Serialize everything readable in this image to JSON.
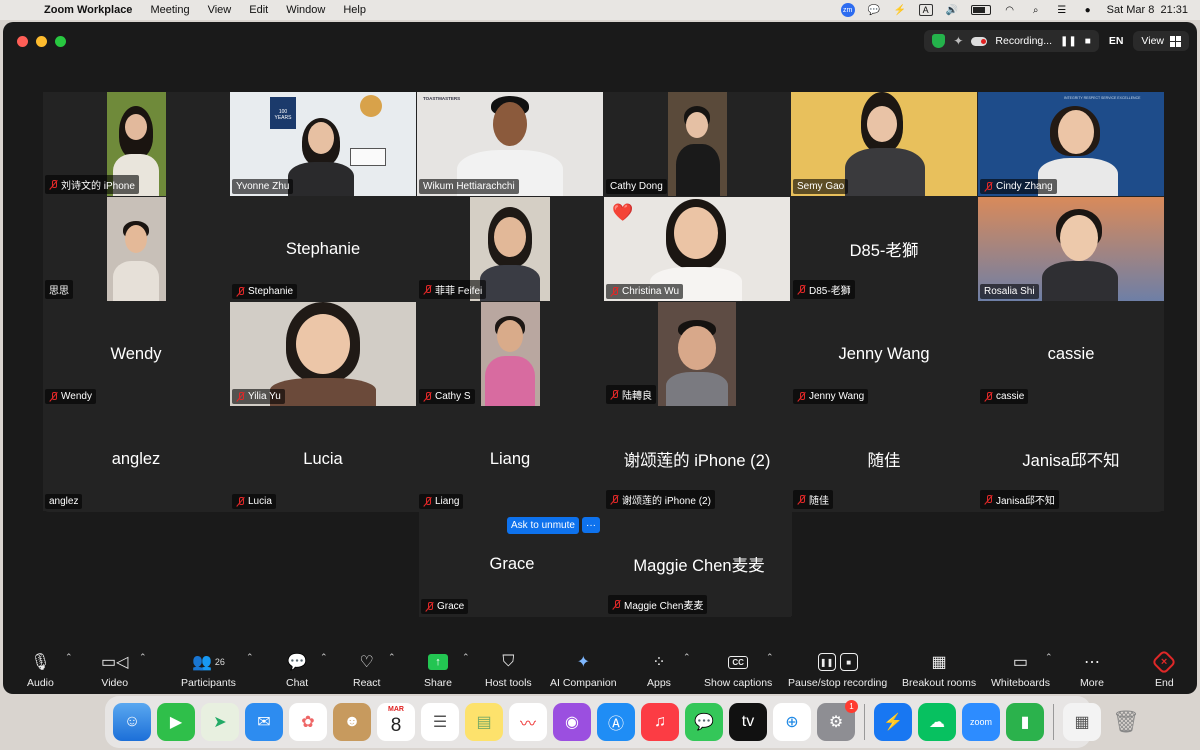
{
  "menubar": {
    "app_name": "Zoom Workplace",
    "menus": [
      "Meeting",
      "View",
      "Edit",
      "Window",
      "Help"
    ],
    "zm_badge": "zm",
    "a_badge": "A",
    "datetime": "Sat Mar 8  21:31"
  },
  "titlebar": {
    "recording_status": "Recording...",
    "language": "EN",
    "view_label": "View"
  },
  "participants": [
    {
      "name": "刘诗文的 iPhone",
      "muted": true,
      "video": true
    },
    {
      "name": "Yvonne Zhu",
      "muted": false,
      "video": true,
      "active": true
    },
    {
      "name": "Wikum Hettiarachchi",
      "muted": false,
      "video": true
    },
    {
      "name": "Cathy Dong",
      "muted": false,
      "video": true
    },
    {
      "name": "Semy Gao",
      "muted": false,
      "video": true
    },
    {
      "name": "Cindy Zhang",
      "muted": true,
      "video": true
    },
    {
      "name": "思思",
      "muted": false,
      "video": true
    },
    {
      "name": "Stephanie",
      "muted": true,
      "video": false
    },
    {
      "name": "菲菲 Feifei",
      "muted": true,
      "video": true
    },
    {
      "name": "Christina Wu",
      "muted": true,
      "video": true
    },
    {
      "name": "D85-老獅",
      "muted": true,
      "video": false
    },
    {
      "name": "Rosalia Shi",
      "muted": true,
      "video": true
    },
    {
      "name": "Wendy",
      "muted": true,
      "video": false
    },
    {
      "name": "Yilia Yu",
      "muted": true,
      "video": true
    },
    {
      "name": "Cathy S",
      "muted": true,
      "video": true
    },
    {
      "name": "陆轉良",
      "muted": true,
      "video": true
    },
    {
      "name": "Jenny Wang",
      "muted": true,
      "video": false
    },
    {
      "name": "cassie",
      "muted": true,
      "video": false
    },
    {
      "name": "anglez",
      "muted": false,
      "video": false
    },
    {
      "name": "Lucia",
      "muted": true,
      "video": false
    },
    {
      "name": "Liang",
      "muted": true,
      "video": false
    },
    {
      "name": "谢颂莲的 iPhone (2)",
      "muted": true,
      "video": false
    },
    {
      "name": "随佳",
      "muted": true,
      "video": false
    },
    {
      "name": "Janisa邱不知",
      "muted": true,
      "video": false
    },
    {
      "name": "Grace",
      "muted": true,
      "video": false
    },
    {
      "name": "Maggie Chen麦麦",
      "muted": true,
      "video": false
    }
  ],
  "reaction_emoji": "❤️",
  "overlay_text": {
    "wikum_banner": "TOASTMASTERS",
    "yvonne_poster": "100 YEARS",
    "cindy_banner": "INTEGRITY   RESPECT   SERVICE   EXCELLENCE"
  },
  "ask_to_unmute": "Ask to unmute",
  "more_dots": "···",
  "toolbar": {
    "audio": "Audio",
    "video": "Video",
    "participants": "Participants",
    "participants_count": "26",
    "chat": "Chat",
    "react": "React",
    "share": "Share",
    "host_tools": "Host tools",
    "ai_companion": "AI Companion",
    "apps": "Apps",
    "show_captions": "Show captions",
    "pause_stop_recording": "Pause/stop recording",
    "breakout_rooms": "Breakout rooms",
    "whiteboards": "Whiteboards",
    "more": "More",
    "end": "End"
  },
  "dock": {
    "calendar_month": "MAR",
    "calendar_day": "8",
    "settings_badge": "1",
    "zoom_label": "zoom"
  },
  "colors": {
    "accent_green": "#23c552",
    "accent_blue": "#0e72ed",
    "mute_red": "#e02828",
    "window_bg": "#1a1a1a",
    "tile_bg": "#232323"
  }
}
